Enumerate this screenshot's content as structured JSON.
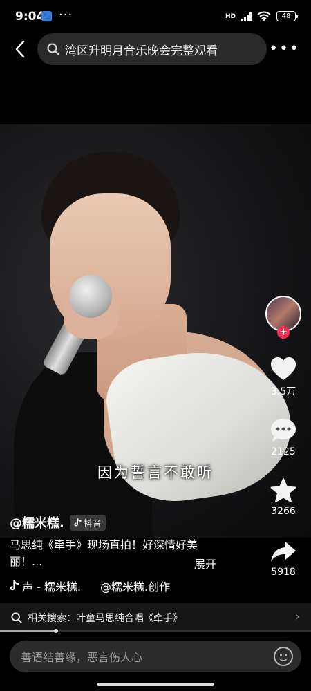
{
  "status_bar": {
    "time": "9:04",
    "network": "HD",
    "battery": "48"
  },
  "header": {
    "search_query": "湾区升明月音乐晚会完整观看"
  },
  "video": {
    "subtitle": "因为誓言不敢听"
  },
  "actions": {
    "likes": "3.5万",
    "comments": "2125",
    "favorites": "3266",
    "shares": "5918"
  },
  "caption": {
    "author": "@糯米糕.",
    "badge": "抖音",
    "description": "马思纯《牵手》现场直拍！好深情好美丽！...",
    "expand": "展开",
    "music": "声 - 糯米糕.",
    "music_creator": "@糯米糕.创作"
  },
  "related_search": {
    "text": "相关搜索：叶童马思纯合唱《牵手》"
  },
  "playback": {
    "progress": 0.18
  },
  "comment_box": {
    "placeholder": "善语结善缘，恶言伤人心"
  }
}
